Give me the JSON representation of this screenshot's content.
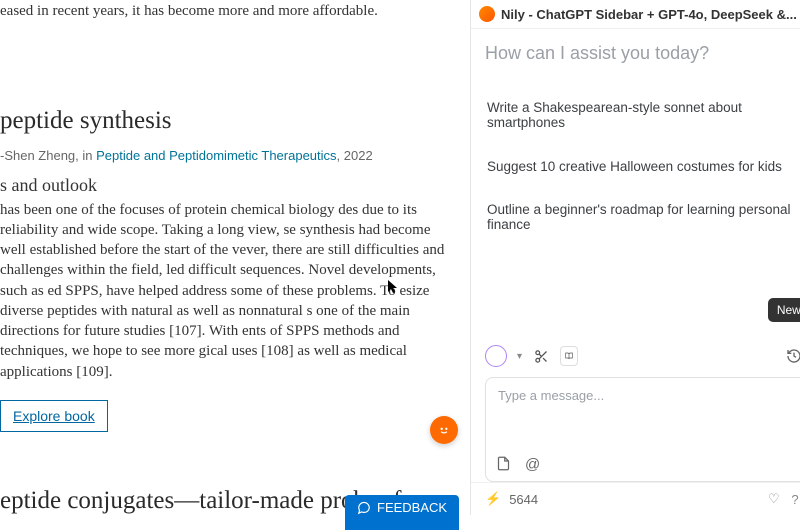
{
  "article": {
    "intro_fragment": "eased in recent years, it has become more and more affordable.",
    "section_title": " peptide synthesis",
    "citation_prefix": "-Shen Zheng, in ",
    "citation_link": "Peptide and Peptidomimetic Therapeutics",
    "citation_year": ", 2022",
    "subheading": "s and outlook",
    "body": " has been one of the focuses of protein chemical biology des due to its reliability and wide scope. Taking a long view, se synthesis had become well established before the start of the vever, there are still difficulties and challenges within the field, led difficult sequences. Novel developments, such as ed SPPS, have helped address some of these problems. To esize diverse peptides with natural as well as nonnatural s one of the main directions for future studies [107]. With ents of SPPS methods and techniques, we hope to see more gical uses [108] as well as medical applications [109].",
    "explore_label": "Explore book",
    "next_section": "eptide conjugates—tailor-made probes fo",
    "feedback_label": "FEEDBACK"
  },
  "sidebar": {
    "title": "Nily - ChatGPT Sidebar + GPT-4o, DeepSeek &...",
    "assist_prompt": "How can I assist you today?",
    "suggestions": [
      "Write a Shakespearean-style sonnet about smartphones",
      "Suggest 10 creative Halloween costumes for kids",
      "Outline a beginner's roadmap for learning personal finance"
    ],
    "input_placeholder": "Type a message...",
    "credits": "5644",
    "tooltip_newchat": "New chat"
  }
}
